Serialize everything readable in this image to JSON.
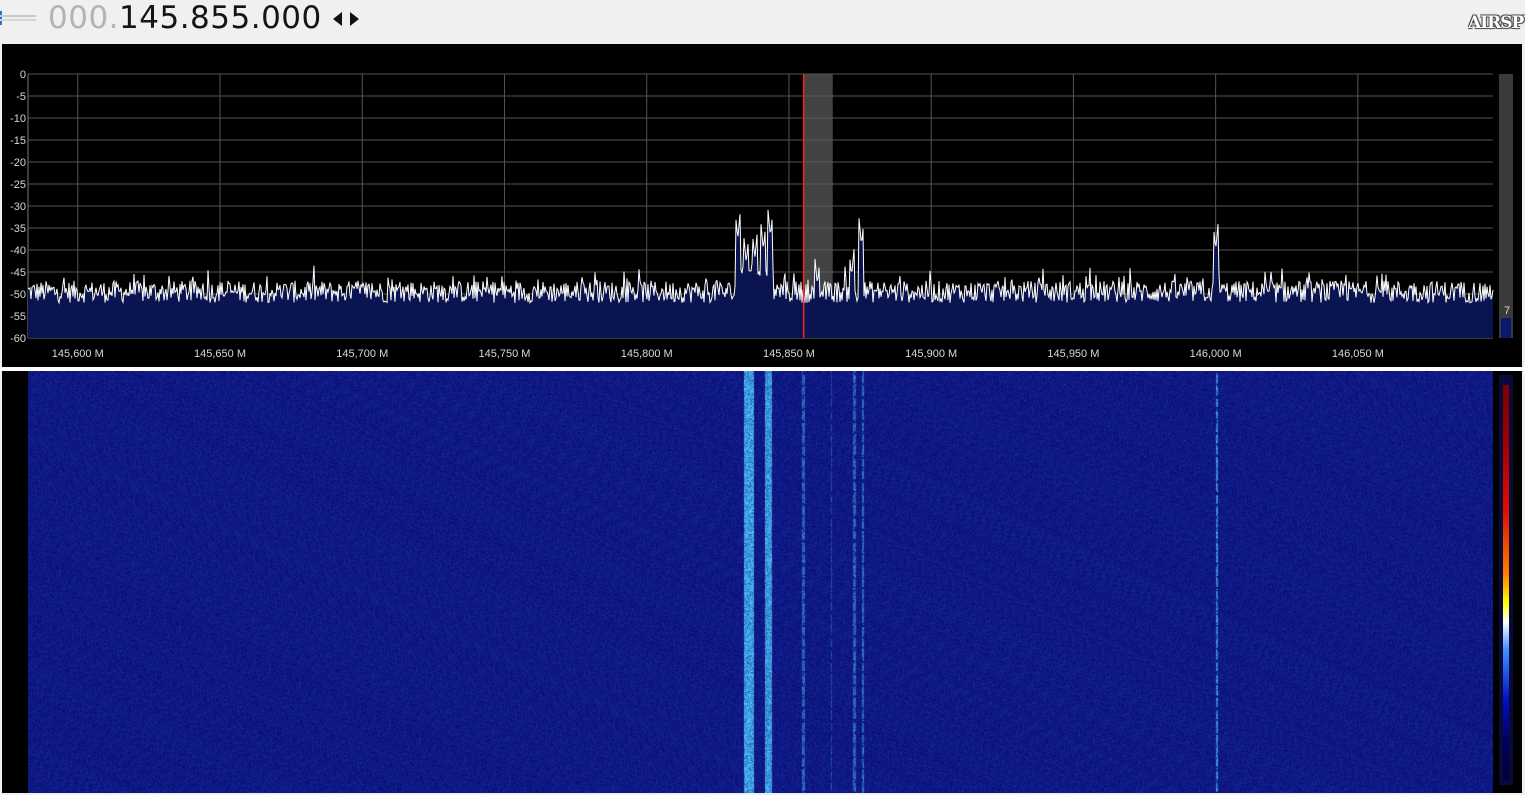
{
  "app": {
    "logo_text": "AIRSPY"
  },
  "toolbar": {
    "frequency_prefix": "000.",
    "frequency_main": "145.855.000",
    "tune_arrows_icon": "left-right-triangle-arrows-icon"
  },
  "spectrum": {
    "scale_value": "7",
    "db_ticks": [
      "0",
      "-5",
      "-10",
      "-15",
      "-20",
      "-25",
      "-30",
      "-35",
      "-40",
      "-45",
      "-50",
      "-55",
      "-60"
    ],
    "freq_ticks": [
      "145,600 M",
      "145,650 M",
      "145,700 M",
      "145,750 M",
      "145,800 M",
      "145,850 M",
      "145,900 M",
      "145,950 M",
      "146,000 M",
      "146,050 M"
    ],
    "colors": {
      "background": "#000000",
      "grid": "#555555",
      "trace": "#ffffff",
      "fill": "#0a1450",
      "tuned_marker": "#ff2020",
      "filter_band": "#5a5a5a"
    }
  },
  "chart_data": {
    "type": "line",
    "xlabel": "",
    "ylabel": "",
    "x_range": [
      145.5825,
      146.0975
    ],
    "ylim": [
      -60,
      0
    ],
    "grid": true,
    "tuned_frequency": 145.855,
    "filter_bandwidth_mhz": 0.0065,
    "noise_floor": -49.5,
    "peaks": [
      {
        "freq": 145.832,
        "level": -37.5
      },
      {
        "freq": 145.835,
        "level": -43
      },
      {
        "freq": 145.838,
        "level": -42
      },
      {
        "freq": 145.841,
        "level": -40
      },
      {
        "freq": 145.8435,
        "level": -37
      },
      {
        "freq": 145.86,
        "level": -48
      },
      {
        "freq": 145.872,
        "level": -46
      },
      {
        "freq": 145.8755,
        "level": -39
      },
      {
        "freq": 146.0,
        "level": -40
      }
    ]
  },
  "waterfall": {
    "colors": {
      "background": "#0a0e70",
      "signal": "#4aa6ff"
    },
    "signal_columns": [
      {
        "freq": 145.834,
        "width_mhz": 0.0035,
        "intensity": 0.9
      },
      {
        "freq": 145.8415,
        "width_mhz": 0.0025,
        "intensity": 0.85
      },
      {
        "freq": 145.8545,
        "width_mhz": 0.0008,
        "intensity": 0.5
      },
      {
        "freq": 145.8645,
        "width_mhz": 0.0006,
        "intensity": 0.35
      },
      {
        "freq": 145.8725,
        "width_mhz": 0.0008,
        "intensity": 0.5
      },
      {
        "freq": 145.8755,
        "width_mhz": 0.0008,
        "intensity": 0.55
      },
      {
        "freq": 146.0,
        "width_mhz": 0.0006,
        "intensity": 0.75
      }
    ]
  }
}
